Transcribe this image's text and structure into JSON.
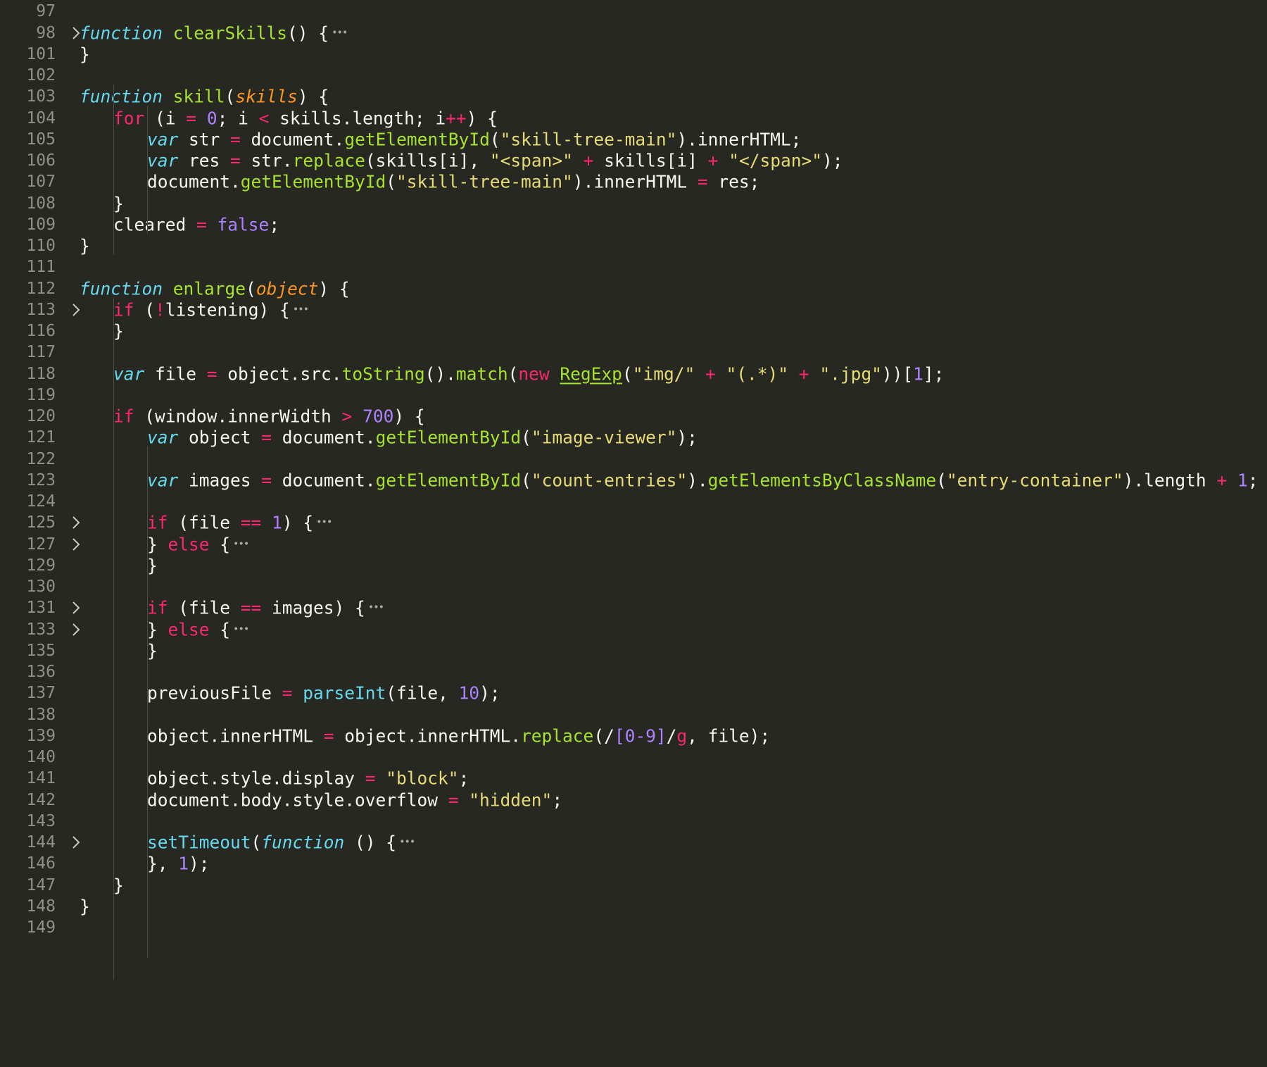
{
  "editor": {
    "colors": {
      "background": "#272822",
      "gutter_text": "#908f89",
      "plain": "#f8f8f2",
      "keyword": "#f92672",
      "storage": "#66d9ef",
      "function_name": "#a6e22e",
      "parameter": "#fd971f",
      "string": "#e6db74",
      "number": "#ae81ff"
    },
    "fold_icon": "chevron-right-icon",
    "lines": [
      {
        "n": "97",
        "indent": 0,
        "fold": false,
        "tokens": []
      },
      {
        "n": "98",
        "indent": 0,
        "fold": true,
        "ellipsis": true,
        "tokens": [
          [
            "sk",
            "function"
          ],
          [
            "pl",
            " "
          ],
          [
            "fn",
            "clearSkills"
          ],
          [
            "pl",
            "() {"
          ]
        ]
      },
      {
        "n": "101",
        "indent": 0,
        "fold": false,
        "tokens": [
          [
            "pl",
            "}"
          ]
        ]
      },
      {
        "n": "102",
        "indent": 0,
        "fold": false,
        "tokens": []
      },
      {
        "n": "103",
        "indent": 0,
        "fold": false,
        "tokens": [
          [
            "sk",
            "function"
          ],
          [
            "pl",
            " "
          ],
          [
            "fn",
            "skill"
          ],
          [
            "pl",
            "("
          ],
          [
            "pa",
            "skills"
          ],
          [
            "pl",
            ") {"
          ]
        ]
      },
      {
        "n": "104",
        "indent": 1,
        "fold": false,
        "tokens": [
          [
            "kw",
            "for"
          ],
          [
            "pl",
            " (i "
          ],
          [
            "op",
            "="
          ],
          [
            "pl",
            " "
          ],
          [
            "nu",
            "0"
          ],
          [
            "pl",
            "; i "
          ],
          [
            "op",
            "<"
          ],
          [
            "pl",
            " skills.length; i"
          ],
          [
            "op",
            "++"
          ],
          [
            "pl",
            ") {"
          ]
        ]
      },
      {
        "n": "105",
        "indent": 2,
        "fold": false,
        "tokens": [
          [
            "sk",
            "var"
          ],
          [
            "pl",
            " str "
          ],
          [
            "op",
            "="
          ],
          [
            "pl",
            " document."
          ],
          [
            "fn",
            "getElementById"
          ],
          [
            "pl",
            "("
          ],
          [
            "st",
            "\"skill-tree-main\""
          ],
          [
            "pl",
            ").innerHTML;"
          ]
        ]
      },
      {
        "n": "106",
        "indent": 2,
        "fold": false,
        "tokens": [
          [
            "sk",
            "var"
          ],
          [
            "pl",
            " res "
          ],
          [
            "op",
            "="
          ],
          [
            "pl",
            " str."
          ],
          [
            "fn",
            "replace"
          ],
          [
            "pl",
            "(skills[i], "
          ],
          [
            "st",
            "\"<span>\""
          ],
          [
            "pl",
            " "
          ],
          [
            "op",
            "+"
          ],
          [
            "pl",
            " skills[i] "
          ],
          [
            "op",
            "+"
          ],
          [
            "pl",
            " "
          ],
          [
            "st",
            "\"</span>\""
          ],
          [
            "pl",
            ");"
          ]
        ]
      },
      {
        "n": "107",
        "indent": 2,
        "fold": false,
        "tokens": [
          [
            "pl",
            "document."
          ],
          [
            "fn",
            "getElementById"
          ],
          [
            "pl",
            "("
          ],
          [
            "st",
            "\"skill-tree-main\""
          ],
          [
            "pl",
            ").innerHTML "
          ],
          [
            "op",
            "="
          ],
          [
            "pl",
            " res;"
          ]
        ]
      },
      {
        "n": "108",
        "indent": 1,
        "fold": false,
        "tokens": [
          [
            "pl",
            "}"
          ]
        ]
      },
      {
        "n": "109",
        "indent": 1,
        "fold": false,
        "tokens": [
          [
            "pl",
            "cleared "
          ],
          [
            "op",
            "="
          ],
          [
            "pl",
            " "
          ],
          [
            "nu",
            "false"
          ],
          [
            "pl",
            ";"
          ]
        ]
      },
      {
        "n": "110",
        "indent": 0,
        "fold": false,
        "tokens": [
          [
            "pl",
            "}"
          ]
        ]
      },
      {
        "n": "111",
        "indent": 0,
        "fold": false,
        "tokens": []
      },
      {
        "n": "112",
        "indent": 0,
        "fold": false,
        "tokens": [
          [
            "sk",
            "function"
          ],
          [
            "pl",
            " "
          ],
          [
            "fn",
            "enlarge"
          ],
          [
            "pl",
            "("
          ],
          [
            "pa",
            "object"
          ],
          [
            "pl",
            ") {"
          ]
        ]
      },
      {
        "n": "113",
        "indent": 1,
        "fold": true,
        "ellipsis": true,
        "tokens": [
          [
            "kw",
            "if"
          ],
          [
            "pl",
            " ("
          ],
          [
            "op",
            "!"
          ],
          [
            "pl",
            "listening) {"
          ]
        ]
      },
      {
        "n": "116",
        "indent": 1,
        "fold": false,
        "tokens": [
          [
            "pl",
            "}"
          ]
        ]
      },
      {
        "n": "117",
        "indent": 0,
        "fold": false,
        "tokens": []
      },
      {
        "n": "118",
        "indent": 1,
        "fold": false,
        "tokens": [
          [
            "sk",
            "var"
          ],
          [
            "pl",
            " file "
          ],
          [
            "op",
            "="
          ],
          [
            "pl",
            " object.src."
          ],
          [
            "fn",
            "toString"
          ],
          [
            "pl",
            "()."
          ],
          [
            "fn",
            "match"
          ],
          [
            "pl",
            "("
          ],
          [
            "kw",
            "new"
          ],
          [
            "pl",
            " "
          ],
          [
            "cl",
            "RegExp"
          ],
          [
            "pl",
            "("
          ],
          [
            "st",
            "\"img/\""
          ],
          [
            "pl",
            " "
          ],
          [
            "op",
            "+"
          ],
          [
            "pl",
            " "
          ],
          [
            "st",
            "\"(.*)\""
          ],
          [
            "pl",
            " "
          ],
          [
            "op",
            "+"
          ],
          [
            "pl",
            " "
          ],
          [
            "st",
            "\".jpg\""
          ],
          [
            "pl",
            "))["
          ],
          [
            "nu",
            "1"
          ],
          [
            "pl",
            "];"
          ]
        ]
      },
      {
        "n": "119",
        "indent": 0,
        "fold": false,
        "tokens": []
      },
      {
        "n": "120",
        "indent": 1,
        "fold": false,
        "tokens": [
          [
            "kw",
            "if"
          ],
          [
            "pl",
            " (window.innerWidth "
          ],
          [
            "op",
            ">"
          ],
          [
            "pl",
            " "
          ],
          [
            "nu",
            "700"
          ],
          [
            "pl",
            ") {"
          ]
        ]
      },
      {
        "n": "121",
        "indent": 2,
        "fold": false,
        "tokens": [
          [
            "sk",
            "var"
          ],
          [
            "pl",
            " object "
          ],
          [
            "op",
            "="
          ],
          [
            "pl",
            " document."
          ],
          [
            "fn",
            "getElementById"
          ],
          [
            "pl",
            "("
          ],
          [
            "st",
            "\"image-viewer\""
          ],
          [
            "pl",
            ");"
          ]
        ]
      },
      {
        "n": "122",
        "indent": 0,
        "fold": false,
        "tokens": []
      },
      {
        "n": "123",
        "indent": 2,
        "fold": false,
        "tokens": [
          [
            "sk",
            "var"
          ],
          [
            "pl",
            " images "
          ],
          [
            "op",
            "="
          ],
          [
            "pl",
            " document."
          ],
          [
            "fn",
            "getElementById"
          ],
          [
            "pl",
            "("
          ],
          [
            "st",
            "\"count-entries\""
          ],
          [
            "pl",
            ")."
          ],
          [
            "fn",
            "getElementsByClassName"
          ],
          [
            "pl",
            "("
          ],
          [
            "st",
            "\"entry-container\""
          ],
          [
            "pl",
            ").length "
          ],
          [
            "op",
            "+"
          ],
          [
            "pl",
            " "
          ],
          [
            "nu",
            "1"
          ],
          [
            "pl",
            ";"
          ]
        ]
      },
      {
        "n": "124",
        "indent": 0,
        "fold": false,
        "tokens": []
      },
      {
        "n": "125",
        "indent": 2,
        "fold": true,
        "ellipsis": true,
        "tokens": [
          [
            "kw",
            "if"
          ],
          [
            "pl",
            " (file "
          ],
          [
            "op",
            "=="
          ],
          [
            "pl",
            " "
          ],
          [
            "nu",
            "1"
          ],
          [
            "pl",
            ") {"
          ]
        ]
      },
      {
        "n": "127",
        "indent": 2,
        "fold": true,
        "ellipsis": true,
        "tokens": [
          [
            "pl",
            "} "
          ],
          [
            "kw",
            "else"
          ],
          [
            "pl",
            " {"
          ]
        ]
      },
      {
        "n": "129",
        "indent": 2,
        "fold": false,
        "tokens": [
          [
            "pl",
            "}"
          ]
        ]
      },
      {
        "n": "130",
        "indent": 0,
        "fold": false,
        "tokens": []
      },
      {
        "n": "131",
        "indent": 2,
        "fold": true,
        "ellipsis": true,
        "tokens": [
          [
            "kw",
            "if"
          ],
          [
            "pl",
            " (file "
          ],
          [
            "op",
            "=="
          ],
          [
            "pl",
            " images) {"
          ]
        ]
      },
      {
        "n": "133",
        "indent": 2,
        "fold": true,
        "ellipsis": true,
        "tokens": [
          [
            "pl",
            "} "
          ],
          [
            "kw",
            "else"
          ],
          [
            "pl",
            " {"
          ]
        ]
      },
      {
        "n": "135",
        "indent": 2,
        "fold": false,
        "tokens": [
          [
            "pl",
            "}"
          ]
        ]
      },
      {
        "n": "136",
        "indent": 0,
        "fold": false,
        "tokens": []
      },
      {
        "n": "137",
        "indent": 2,
        "fold": false,
        "tokens": [
          [
            "pl",
            "previousFile "
          ],
          [
            "op",
            "="
          ],
          [
            "pl",
            " "
          ],
          [
            "su",
            "parseInt"
          ],
          [
            "pl",
            "(file, "
          ],
          [
            "nu",
            "10"
          ],
          [
            "pl",
            ");"
          ]
        ]
      },
      {
        "n": "138",
        "indent": 0,
        "fold": false,
        "tokens": []
      },
      {
        "n": "139",
        "indent": 2,
        "fold": false,
        "tokens": [
          [
            "pl",
            "object.innerHTML "
          ],
          [
            "op",
            "="
          ],
          [
            "pl",
            " object.innerHTML."
          ],
          [
            "fn",
            "replace"
          ],
          [
            "pl",
            "(/"
          ],
          [
            "nu",
            "[0-9]"
          ],
          [
            "pl",
            "/"
          ],
          [
            "kw",
            "g"
          ],
          [
            "pl",
            ", file);"
          ]
        ]
      },
      {
        "n": "140",
        "indent": 0,
        "fold": false,
        "tokens": []
      },
      {
        "n": "141",
        "indent": 2,
        "fold": false,
        "tokens": [
          [
            "pl",
            "object.style.display "
          ],
          [
            "op",
            "="
          ],
          [
            "pl",
            " "
          ],
          [
            "st",
            "\"block\""
          ],
          [
            "pl",
            ";"
          ]
        ]
      },
      {
        "n": "142",
        "indent": 2,
        "fold": false,
        "tokens": [
          [
            "pl",
            "document.body.style.overflow "
          ],
          [
            "op",
            "="
          ],
          [
            "pl",
            " "
          ],
          [
            "st",
            "\"hidden\""
          ],
          [
            "pl",
            ";"
          ]
        ]
      },
      {
        "n": "143",
        "indent": 0,
        "fold": false,
        "tokens": []
      },
      {
        "n": "144",
        "indent": 2,
        "fold": true,
        "ellipsis": true,
        "tokens": [
          [
            "su",
            "setTimeout"
          ],
          [
            "pl",
            "("
          ],
          [
            "sk",
            "function"
          ],
          [
            "pl",
            " () {"
          ]
        ]
      },
      {
        "n": "146",
        "indent": 2,
        "fold": false,
        "tokens": [
          [
            "pl",
            "}, "
          ],
          [
            "nu",
            "1"
          ],
          [
            "pl",
            ");"
          ]
        ]
      },
      {
        "n": "147",
        "indent": 1,
        "fold": false,
        "tokens": [
          [
            "pl",
            "}"
          ]
        ]
      },
      {
        "n": "148",
        "indent": 0,
        "fold": false,
        "tokens": [
          [
            "pl",
            "}"
          ]
        ]
      },
      {
        "n": "149",
        "indent": 0,
        "fold": false,
        "tokens": []
      }
    ]
  }
}
